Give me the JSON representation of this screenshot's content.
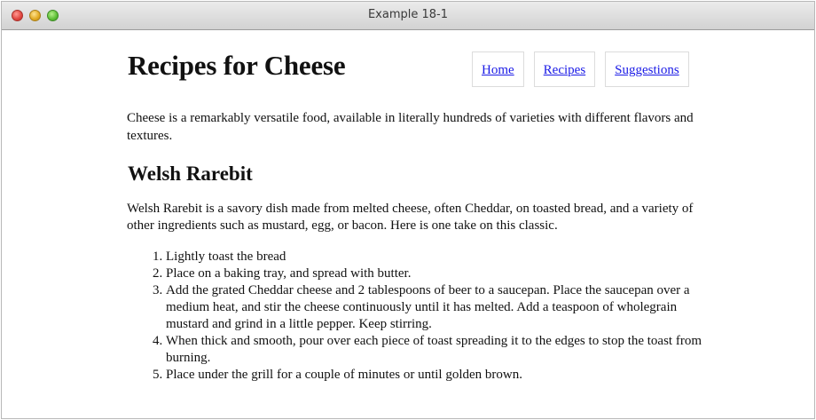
{
  "window": {
    "title": "Example 18-1"
  },
  "header": {
    "title": "Recipes for Cheese",
    "nav": [
      {
        "label": "Home"
      },
      {
        "label": "Recipes"
      },
      {
        "label": "Suggestions"
      }
    ]
  },
  "intro": "Cheese is a remarkably versatile food, available in literally hundreds of varieties with different flavors and textures.",
  "section": {
    "title": "Welsh Rarebit",
    "description": "Welsh Rarebit is a savory dish made from melted cheese, often Cheddar, on toasted bread, and a variety of other ingredients such as mustard, egg, or bacon. Here is one take on this classic.",
    "steps": [
      "Lightly toast the bread",
      "Place on a baking tray, and spread with butter.",
      "Add the grated Cheddar cheese and 2 tablespoons of beer to a saucepan. Place the saucepan over a medium heat, and stir the cheese continuously until it has melted. Add a teaspoon of wholegrain mustard and grind in a little pepper. Keep stirring.",
      "When thick and smooth, pour over each piece of toast spreading it to the edges to stop the toast from burning.",
      "Place under the grill for a couple of minutes or until golden brown."
    ]
  },
  "icons": {
    "close": "close-button-icon",
    "minimize": "minimize-button-icon",
    "zoom": "zoom-button-icon"
  }
}
